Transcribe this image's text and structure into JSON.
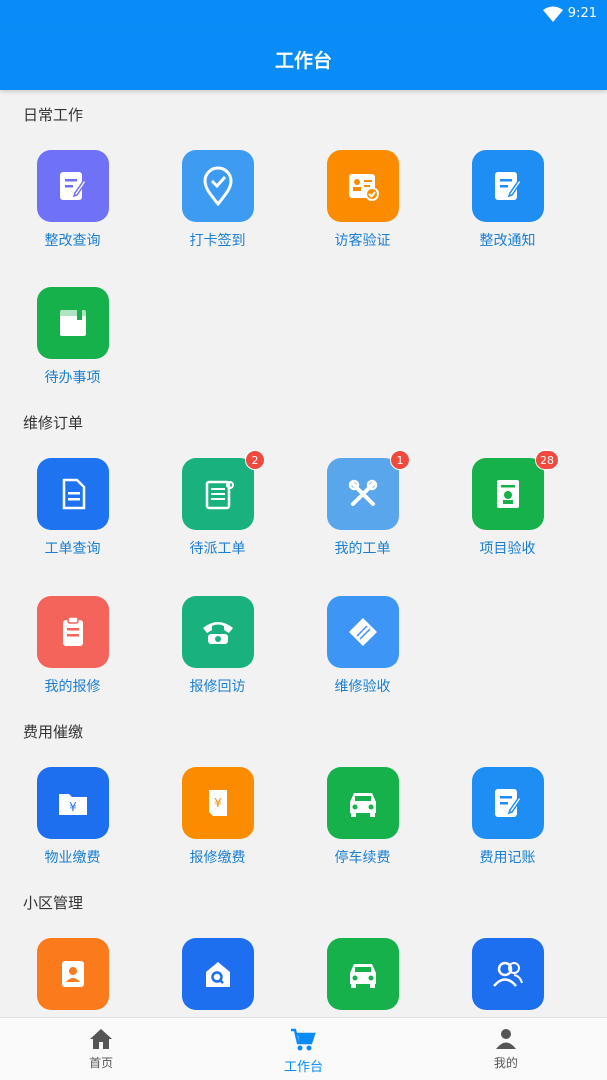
{
  "status": {
    "time": "9:21"
  },
  "header": {
    "title": "工作台"
  },
  "sections": {
    "daily": {
      "title": "日常工作",
      "items": [
        "整改查询",
        "打卡签到",
        "访客验证",
        "整改通知",
        "待办事项"
      ]
    },
    "repair": {
      "title": "维修订单",
      "items": [
        "工单查询",
        "待派工单",
        "我的工单",
        "项目验收",
        "我的报修",
        "报修回访",
        "维修验收"
      ],
      "badges": {
        "pending": "2",
        "mine": "1",
        "accept": "28"
      }
    },
    "fee": {
      "title": "费用催缴",
      "items": [
        "物业缴费",
        "报修缴费",
        "停车续费",
        "费用记账"
      ]
    },
    "community": {
      "title": "小区管理"
    }
  },
  "tabs": [
    "首页",
    "工作台",
    "我的"
  ],
  "colors": {
    "primary": "#0a8cf8",
    "badge": "#f04a3e",
    "label": "#1a7fd4"
  }
}
